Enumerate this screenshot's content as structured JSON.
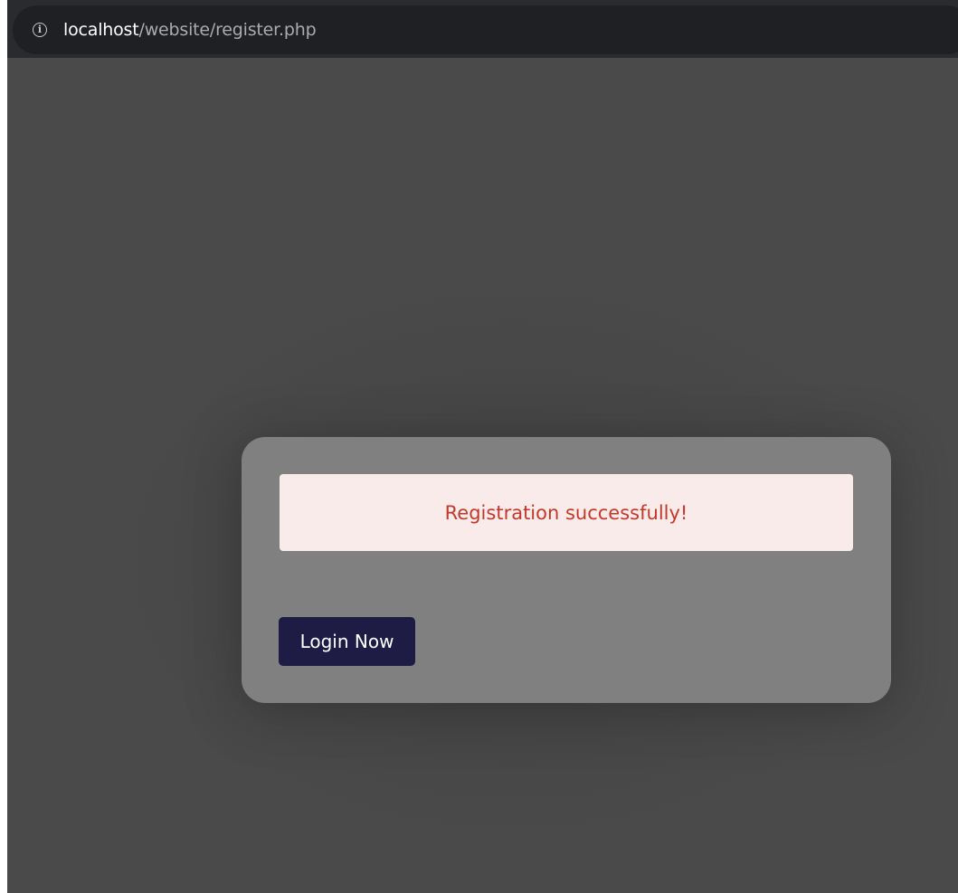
{
  "browser": {
    "url_host": "localhost",
    "url_path": "/website/register.php",
    "info_icon_glyph": "i"
  },
  "page": {
    "message": "Registration successfully!",
    "login_button_label": "Login Now"
  },
  "colors": {
    "page_background": "#4a4a4a",
    "card_background": "#808080",
    "message_background": "#f9ebea",
    "message_text": "#c0392b",
    "button_background": "#1e1b45",
    "button_text": "#ffffff"
  }
}
